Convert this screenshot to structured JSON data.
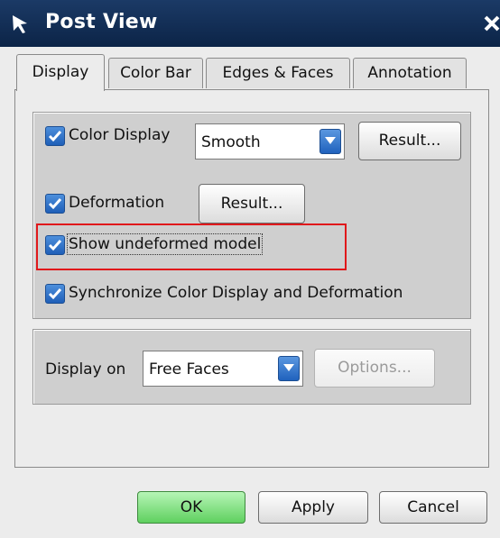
{
  "window": {
    "title": "Post View",
    "title_icon": "arrow-cursor-icon",
    "close_icon": "close-icon"
  },
  "tabs": [
    {
      "label": "Display",
      "active": true
    },
    {
      "label": "Color Bar",
      "active": false
    },
    {
      "label": "Edges & Faces",
      "active": false
    },
    {
      "label": "Annotation",
      "active": false
    }
  ],
  "display_group": {
    "color_display": {
      "label": "Color Display",
      "checked": true,
      "select_value": "Smooth",
      "result_button": "Result..."
    },
    "deformation": {
      "label": "Deformation",
      "checked": true,
      "result_button": "Result..."
    },
    "show_undeformed": {
      "label": "Show undeformed model",
      "checked": true
    },
    "synchronize": {
      "label": "Synchronize Color Display and Deformation",
      "checked": true
    }
  },
  "display_on_group": {
    "label": "Display on",
    "select_value": "Free Faces",
    "options_button": "Options...",
    "options_enabled": false
  },
  "footer": {
    "ok": "OK",
    "apply": "Apply",
    "cancel": "Cancel"
  },
  "colors": {
    "titlebar": "#0e2a4f",
    "highlight": "#e0181b",
    "ok_button": "#5fd05f",
    "checkbox": "#1f5fb8"
  }
}
